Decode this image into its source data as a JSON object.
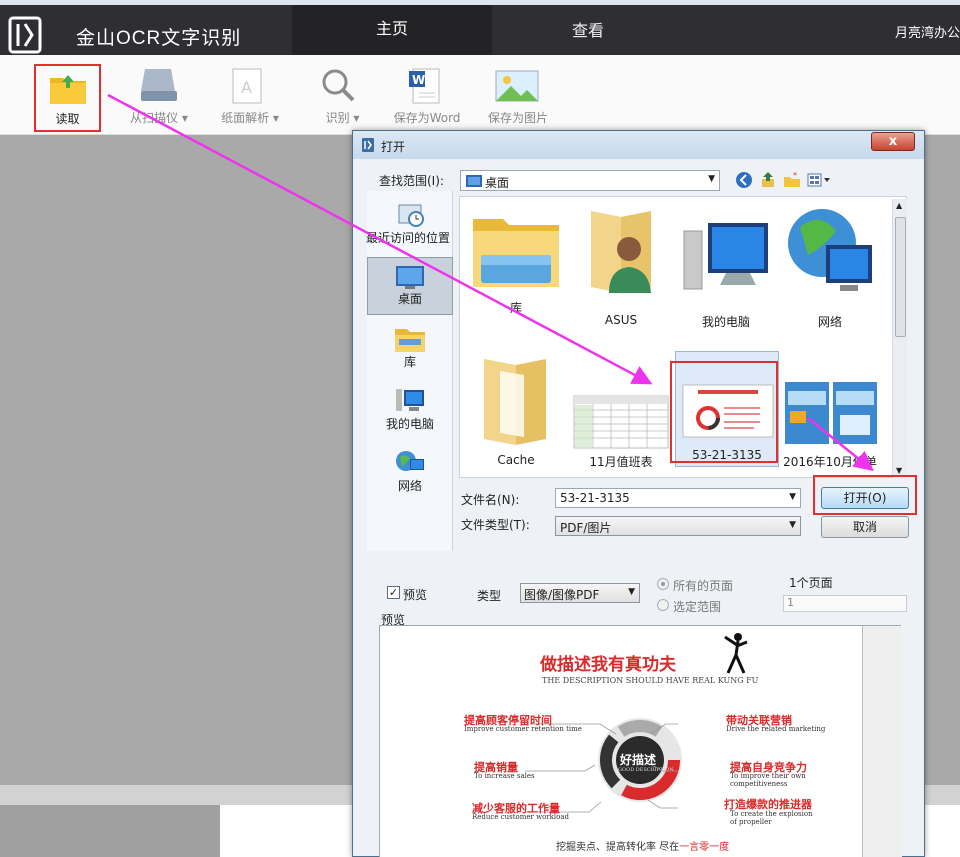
{
  "app": {
    "title": "金山OCR文字识别",
    "user": "月亮湾办公"
  },
  "tabs": [
    "主页",
    "查看"
  ],
  "ribbon": {
    "read": "读取",
    "scanner": "从扫描仪",
    "paper": "纸面解析",
    "recognize": "识别",
    "save_word": "保存为Word",
    "save_image": "保存为图片"
  },
  "dialog": {
    "title": "打开",
    "close": "x",
    "lookin_label": "查找范围(I):",
    "lookin_value": "桌面",
    "places": [
      "最近访问的位置",
      "桌面",
      "库",
      "我的电脑",
      "网络"
    ],
    "files": [
      "库",
      "ASUS",
      "我的电脑",
      "网络",
      "Cache",
      "11月值班表",
      "53-21-3135",
      "2016年10月传单"
    ],
    "filename_label": "文件名(N):",
    "filename_value": "53-21-3135",
    "filetype_label": "文件类型(T):",
    "filetype_value": "PDF/图片",
    "open_button": "打开(O)",
    "cancel_button": "取消",
    "preview_check": "预览",
    "type_label": "类型",
    "type_value": "图像/图像PDF",
    "radio_all": "所有的页面",
    "radio_range": "选定范围",
    "pages_count": "1个页面",
    "pages_input": "1",
    "preview_label": "预览"
  },
  "preview_doc": {
    "title": "做描述我有真功夫",
    "subtitle": "THE DESCRIPTION SHOULD HAVE REAL KUNG FU",
    "center": "好描述",
    "center_sub": "GOOD DESCRIPTION",
    "items": [
      {
        "cn": "提高顾客停留时间",
        "en": "Improve customer retention time"
      },
      {
        "cn": "带动关联营销",
        "en": "Drive the related marketing"
      },
      {
        "cn": "提高销量",
        "en": "To increase sales"
      },
      {
        "cn": "提高自身竞争力",
        "en": "To improve their own"
      },
      {
        "cn": "减少客服的工作量",
        "en": "Reduce customer workload"
      },
      {
        "cn": "打造爆款的推进器",
        "en": "To create the explosion"
      }
    ],
    "item4_en2": "competitiveness",
    "item6_en2": "of propeller",
    "footer": "挖掘卖点、提高转化率 尽在",
    "footer_red": "一言零一度"
  },
  "colors": {
    "accent_red": "#e23030",
    "annotation": "#ee33ee"
  }
}
